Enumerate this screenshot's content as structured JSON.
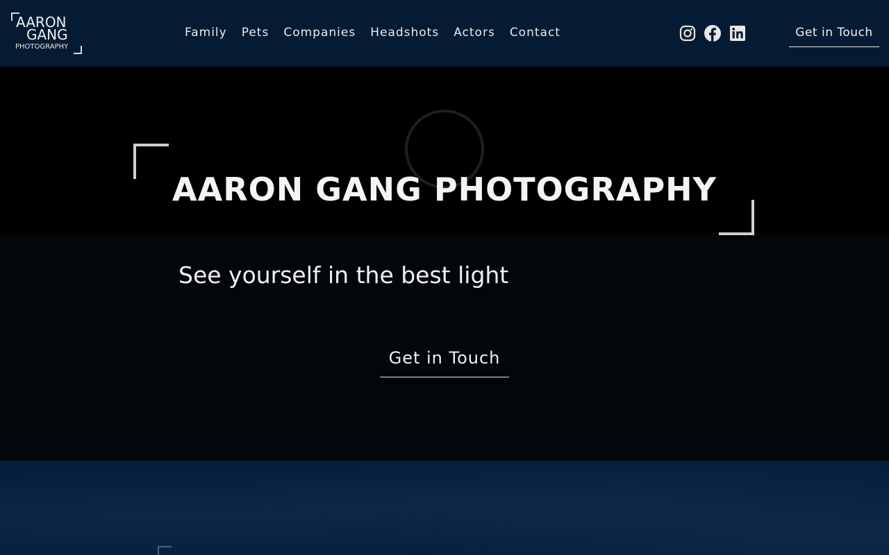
{
  "logo": {
    "line1": "AARON",
    "line2": "GANG",
    "line3": "PHOTOGRAPHY"
  },
  "nav": {
    "items": [
      {
        "label": "Family"
      },
      {
        "label": "Pets"
      },
      {
        "label": "Companies"
      },
      {
        "label": "Headshots"
      },
      {
        "label": "Actors"
      },
      {
        "label": "Contact"
      }
    ]
  },
  "social": {
    "icons": [
      "instagram-icon",
      "facebook-icon",
      "linkedin-icon"
    ]
  },
  "header": {
    "cta_label": "Get in Touch"
  },
  "hero": {
    "title": "AARON GANG PHOTOGRAPHY",
    "subtitle": "See yourself in the best light",
    "cta_label": "Get in Touch"
  },
  "colors": {
    "header_bg": "#051b34",
    "hero_top_bg": "#000000",
    "hero_bottom_bg": "#03070c",
    "next_section_bg": "#05203f",
    "text": "#f2f2f2"
  }
}
